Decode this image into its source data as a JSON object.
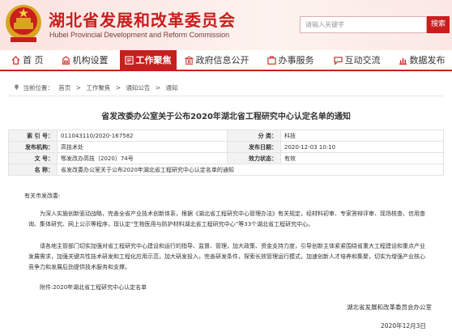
{
  "site": {
    "title": "湖北省发展和改革委员会",
    "subtitle": "Hubei Provincial Development and Reform Commission",
    "search_placeholder": "请输入关键字",
    "search_button": "搜索"
  },
  "nav": {
    "items": [
      {
        "label": "首  页",
        "icon": "home-icon"
      },
      {
        "label": "机构设置",
        "icon": "building-icon"
      },
      {
        "label": "工作聚焦",
        "icon": "target-icon",
        "active": true
      },
      {
        "label": "政府信息公开",
        "icon": "government-icon"
      },
      {
        "label": "办事服务",
        "icon": "service-icon"
      },
      {
        "label": "互动交流",
        "icon": "chat-icon"
      },
      {
        "label": "数据发布",
        "icon": "chart-icon"
      }
    ]
  },
  "breadcrumb": {
    "prefix": "当前位置：",
    "items": [
      "首页",
      ">",
      "工作聚焦",
      ">",
      "通知公告",
      ">",
      "通知"
    ]
  },
  "article": {
    "title": "省发改委办公室关于公布2020年湖北省工程研究中心认定名单的通知",
    "meta": {
      "index_label": "索 引 号：",
      "index_value": "011043110/2020-167582",
      "category_label": "分    类：",
      "category_value": "科技",
      "issuer_label": "发布机构：",
      "issuer_value": "高技术处",
      "date_label": "发布日期：",
      "date_value": "2020-12-03 10:10",
      "docno_label": "文    号：",
      "docno_value": "鄂发改办高技〔2020〕74号",
      "validity_label": "效力状态：",
      "validity_value": "有效",
      "name_label": "名    称：",
      "name_value": "省发改委办公室关于公布2020年湖北省工程研究中心认定名单的通知"
    },
    "salutation": "有关市发改委:",
    "para1": "为深入实施创新驱动战略，完善全省产业技术创新体系，根据《湖北省工程研究中心管理办法》有关规定，经材料初审、专家答辩评审、现场核查、信用查询、集体研究、网上公示等程序，现认定“生物医用与防护材料湖北省工程研究中心”等33个湖北省工程研究中心。",
    "para2": "请各地主管部门切实加强对省工程研究中心建设和运行的指导、监督、管理，加大政策、资金支持力度，引导创新主体紧紧围绕省重大工程建设和重点产业发展需求，加强关键共性技术研发和工程化应用示范，加大研发投入，完善研发条件，探索长效管理运行模式，加速创新人才培养和集聚，切实为增强产业核心竞争力和发展后劲提供技术服务和支撑。",
    "attachment": "附件:2020年湖北省工程研究中心认定名单",
    "signature": "湖北省发展和改革委员会办公室",
    "date": "2020年12月3日"
  },
  "colors": {
    "brand": "#c81e1e",
    "header_bg": "#fbe3e0"
  }
}
